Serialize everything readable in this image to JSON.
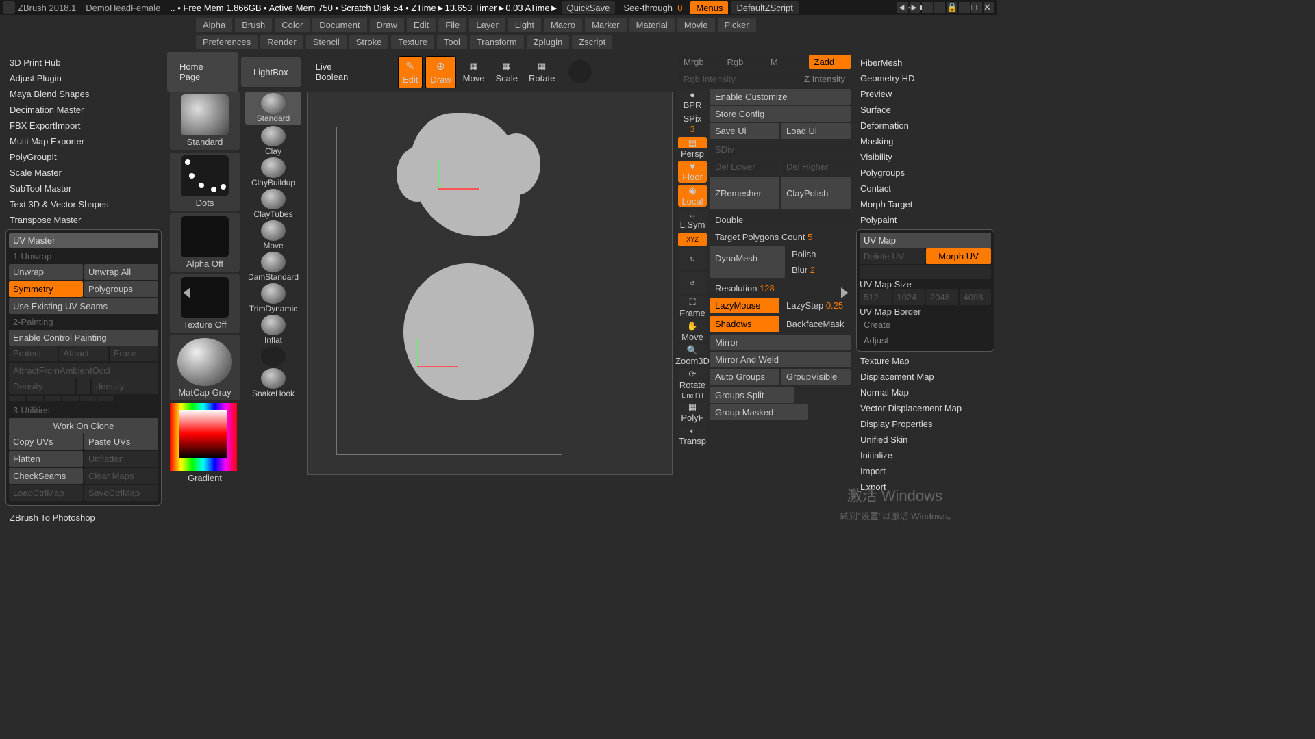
{
  "top": {
    "app": "ZBrush 2018.1",
    "project": "DemoHeadFemale",
    "info": ".. • Free Mem 1.866GB • Active Mem 750 • Scratch Disk 54 • ZTime►13.653 Timer►0.03 ATime►",
    "quicksave": "QuickSave",
    "seethrough": "See-through",
    "seethrough_val": "0",
    "menus": "Menus",
    "script": "DefaultZScript"
  },
  "menu": [
    "Alpha",
    "Brush",
    "Color",
    "Document",
    "Draw",
    "Edit",
    "File",
    "Layer",
    "Light",
    "Macro",
    "Marker",
    "Material",
    "Movie",
    "Picker",
    "Preferences",
    "Render",
    "Stencil",
    "Stroke",
    "Texture",
    "Tool",
    "Transform",
    "Zplugin",
    "Zscript"
  ],
  "left": {
    "plugins": [
      "3D Print Hub",
      "Adjust Plugin",
      "Maya Blend Shapes",
      "Decimation Master",
      "FBX ExportImport",
      "Multi Map Exporter",
      "PolyGroupIt",
      "Scale Master",
      "SubTool Master",
      "Text 3D & Vector Shapes",
      "Transpose Master",
      "UV Master"
    ],
    "s1": "1-Unwrap",
    "unwrap": "Unwrap",
    "unwrapall": "Unwrap All",
    "symmetry": "Symmetry",
    "polygroups": "Polygroups",
    "useexist": "Use Existing UV Seams",
    "s2": "2-Painting",
    "enablecp": "Enable Control Painting",
    "protect": "Protect",
    "attract": "Attract",
    "erase": "Erase",
    "density": "Density",
    "densityval": "density.",
    "s3": "3-Utilities",
    "workclone": "Work On Clone",
    "copyuv": "Copy UVs",
    "pasteuv": "Paste UVs",
    "flatten": "Flatten",
    "unflatten": "Unflatten",
    "checkseam": "CheckSeams",
    "clearmaps": "Clear Maps",
    "zbps": "ZBrush To Photoshop"
  },
  "tools": {
    "home": "Home Page",
    "lightbox": "LightBox",
    "liveb": "Live Boolean",
    "edit": "Edit",
    "draw": "Draw",
    "move": "Move",
    "scale": "Scale",
    "rotate": "Rotate",
    "standard": "Standard",
    "dots": "Dots",
    "alphaoff": "Alpha Off",
    "texoff": "Texture Off",
    "matcap": "MatCap Gray",
    "gradient": "Gradient"
  },
  "brushes": [
    "Standard",
    "Clay",
    "ClayBuildup",
    "ClayTubes",
    "Move",
    "DamStandard",
    "TrimDynamic",
    "Inflat",
    "",
    "SnakeHook"
  ],
  "mode": {
    "mrgb": "Mrgb",
    "rgb": "Rgb",
    "m": "M",
    "zadd": "Zadd",
    "rgbi": "Rgb Intensity",
    "zi": "Z Intensity"
  },
  "right": {
    "bpr": "BPR",
    "spix": "SPix",
    "spixv": "3",
    "persp": "Persp",
    "floor": "Floor",
    "local": "Local",
    "lsym": "L.Sym",
    "xyz": "XYZ",
    "frame": "Frame",
    "move": "Move",
    "zoom": "Zoom3D",
    "rotate": "Rotate",
    "linefill": "Line Fill",
    "polyf": "PolyF",
    "transp": "Transp",
    "enablec": "Enable Customize",
    "store": "Store Config",
    "saveui": "Save Ui",
    "loadui": "Load Ui",
    "sdiv": "SDiv",
    "dlow": "Del Lower",
    "dhigh": "Del Higher",
    "zrem": "ZRemesher",
    "clayp": "ClayPolish",
    "double": "Double",
    "tpc": "Target Polygons Count",
    "tpcv": "5",
    "dyna": "DynaMesh",
    "polish": "Polish",
    "blur": "Blur",
    "blurv": "2",
    "res": "Resolution",
    "resv": "128",
    "lazy": "LazyMouse",
    "lstep": "LazyStep",
    "lstepv": "0.25",
    "shadows": "Shadows",
    "backf": "BackfaceMask",
    "mirror": "Mirror",
    "mirrorw": "Mirror And Weld",
    "autog": "Auto Groups",
    "gvis": "GroupVisible",
    "gsplit": "Groups Split",
    "gmask": "Group Masked"
  },
  "far": {
    "items1": [
      "FiberMesh",
      "Geometry HD",
      "Preview",
      "Surface",
      "Deformation",
      "Masking",
      "Visibility",
      "Polygroups",
      "Contact",
      "Morph Target",
      "Polypaint",
      "UV Map"
    ],
    "morphuv": "Morph UV",
    "uvsize": "UV Map Size",
    "uvborder": "UV Map Border",
    "create": "Create",
    "adjust": "Adjust",
    "items2": [
      "Texture Map",
      "Displacement Map",
      "Normal Map",
      "Vector Displacement Map",
      "Display Properties",
      "Unified Skin",
      "Initialize",
      "Import",
      "Export"
    ]
  },
  "wm1": "激活 Windows",
  "wm2": "转到\"设置\"以激活 Windows。"
}
